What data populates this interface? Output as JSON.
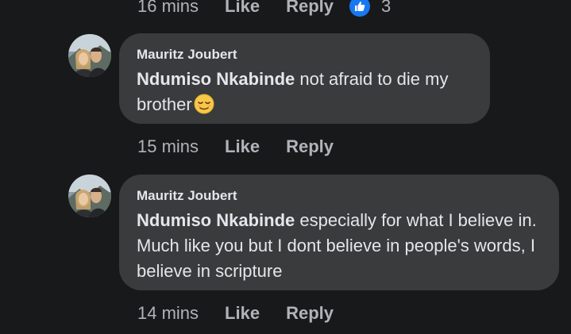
{
  "colors": {
    "background": "#18191a",
    "bubble": "#3a3b3c",
    "text_primary": "#e4e6eb",
    "text_secondary": "#b0b3b8",
    "like_blue": "#1877f2"
  },
  "top_actions": {
    "time": "16 mins",
    "like_label": "Like",
    "reply_label": "Reply",
    "reaction_icon": "like-icon",
    "reaction_count": "3"
  },
  "comments": [
    {
      "avatar_icon": "profile-photo",
      "author": "Mauritz Joubert",
      "mention": "Ndumiso Nkabinde",
      "text": " not afraid to die my brother",
      "emoji": "relieved-face-emoji",
      "time": "15 mins",
      "like_label": "Like",
      "reply_label": "Reply"
    },
    {
      "avatar_icon": "profile-photo",
      "author": "Mauritz Joubert",
      "mention": "Ndumiso Nkabinde",
      "text": " especially for what I believe in. Much like you but I dont believe in people's words, I believe in scripture",
      "time": "14 mins",
      "like_label": "Like",
      "reply_label": "Reply"
    }
  ]
}
